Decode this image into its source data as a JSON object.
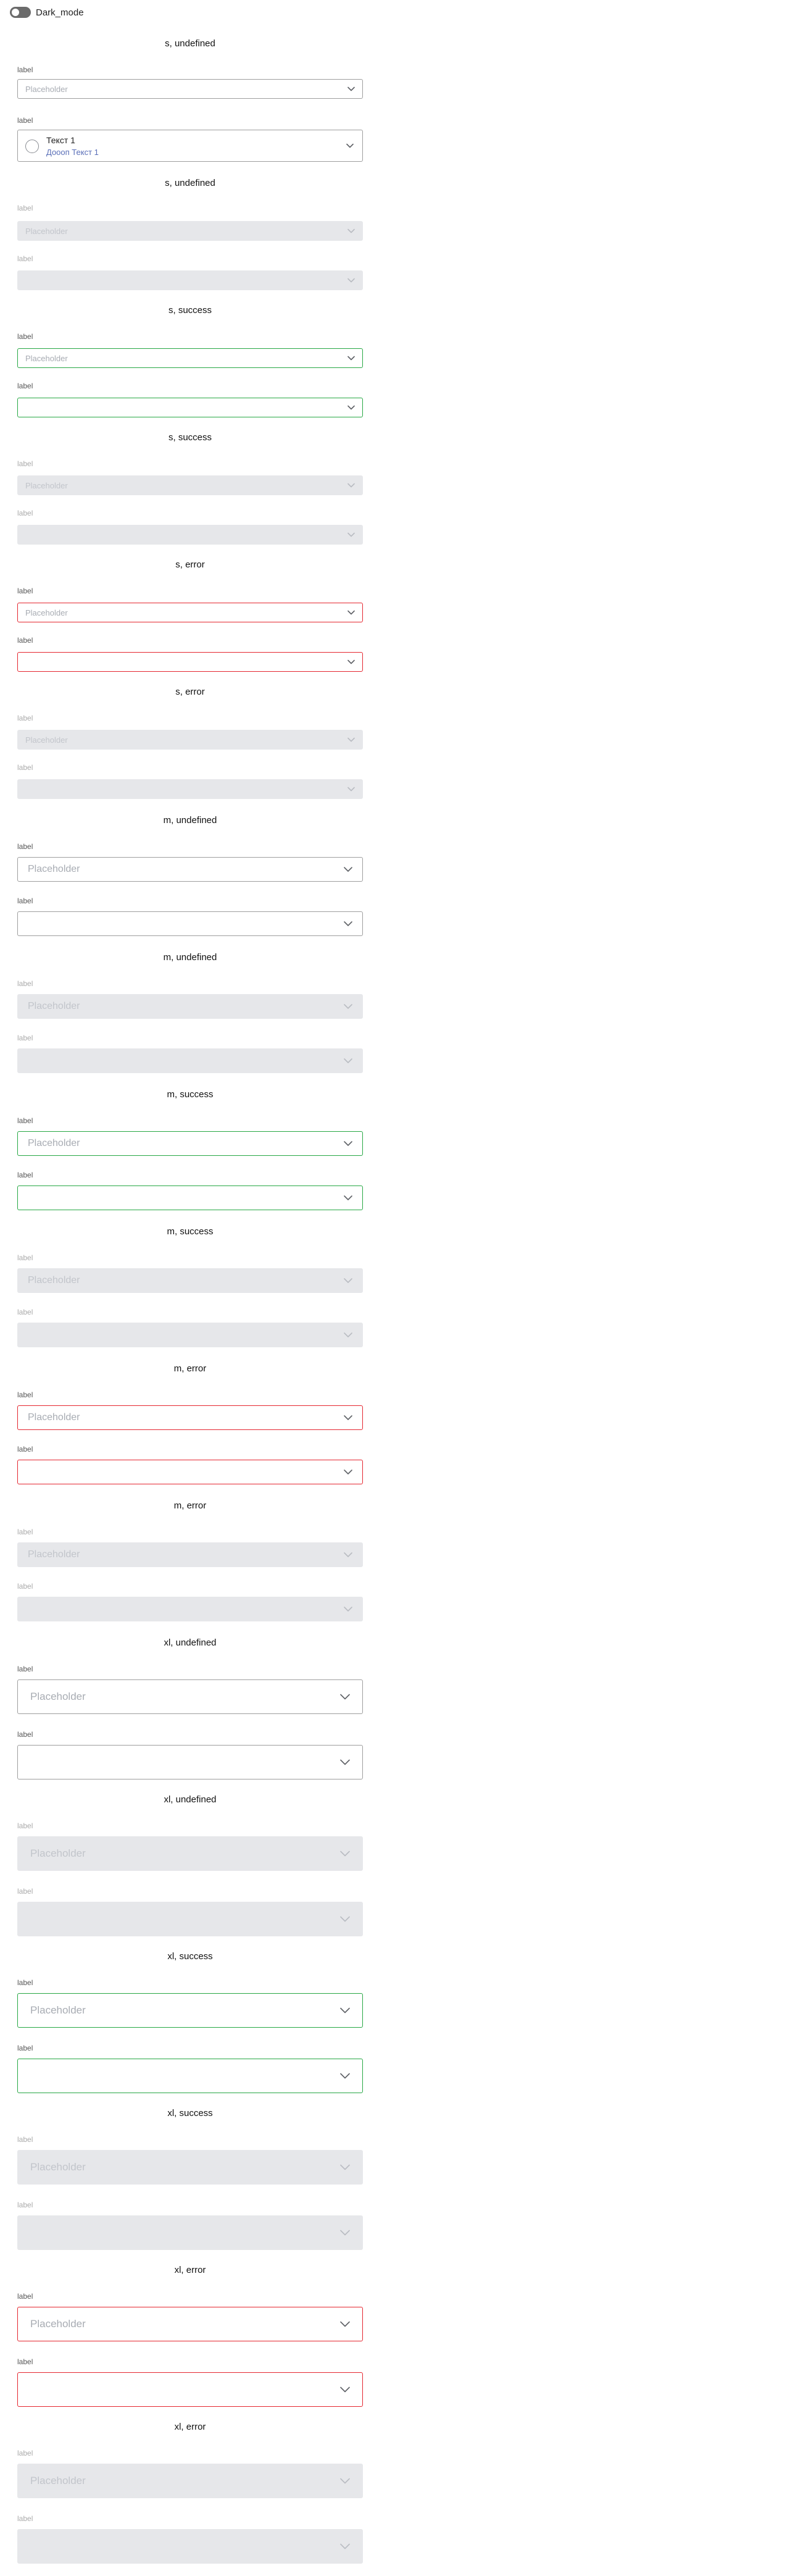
{
  "toggle": {
    "label": "Dark_mode"
  },
  "common": {
    "label": "label",
    "placeholder": "Placeholder"
  },
  "item": {
    "text": "Текст 1",
    "subtext": "Доооп Текст 1"
  },
  "sections": [
    {
      "title": "s, undefined"
    },
    {
      "title": "s, undefined"
    },
    {
      "title": "s, success"
    },
    {
      "title": "s, success"
    },
    {
      "title": "s, error"
    },
    {
      "title": "s, error"
    },
    {
      "title": "m, undefined"
    },
    {
      "title": "m, undefined"
    },
    {
      "title": "m, success"
    },
    {
      "title": "m, success"
    },
    {
      "title": "m, error"
    },
    {
      "title": "m, error"
    },
    {
      "title": "xl, undefined"
    },
    {
      "title": "xl, undefined"
    },
    {
      "title": "xl, success"
    },
    {
      "title": "xl, success"
    },
    {
      "title": "xl, error"
    },
    {
      "title": "xl, error"
    }
  ],
  "colors": {
    "success": "#27a844",
    "error": "#e5262f",
    "disabled_bg": "#e6e7ea",
    "border": "#9e9e9e"
  }
}
